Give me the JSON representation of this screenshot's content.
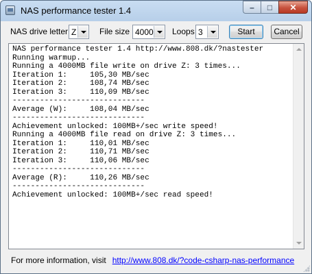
{
  "window": {
    "title": "NAS performance tester 1.4"
  },
  "toolbar": {
    "drive_label": "NAS drive letter",
    "drive_value": "Z",
    "filesize_label": "File size",
    "filesize_value": "4000",
    "loops_label": "Loops",
    "loops_value": "3",
    "start_label": "Start",
    "cancel_label": "Cancel"
  },
  "log": {
    "lines": [
      "NAS performance tester 1.4 http://www.808.dk/?nastester",
      "Running warmup...",
      "Running a 4000MB file write on drive Z: 3 times...",
      "Iteration 1:     105,30 MB/sec",
      "Iteration 2:     108,74 MB/sec",
      "Iteration 3:     110,09 MB/sec",
      "-----------------------------",
      "Average (W):     108,04 MB/sec",
      "-----------------------------",
      "Achievement unlocked: 100MB+/sec write speed!",
      "Running a 4000MB file read on drive Z: 3 times...",
      "Iteration 1:     110,01 MB/sec",
      "Iteration 2:     110,71 MB/sec",
      "Iteration 3:     110,06 MB/sec",
      "-----------------------------",
      "Average (R):     110,26 MB/sec",
      "-----------------------------",
      "Achievement unlocked: 100MB+/sec read speed!"
    ]
  },
  "footer": {
    "text": "For more information, visit",
    "link": "http://www.808.dk/?code-csharp-nas-performance"
  }
}
